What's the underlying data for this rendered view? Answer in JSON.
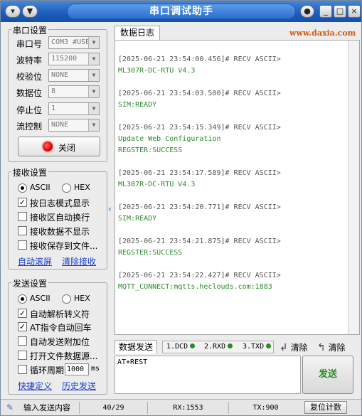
{
  "window": {
    "title": "串口调试助手",
    "app_icon": "▾",
    "menu_icon": "▼",
    "pin_icon": "●",
    "min_icon": "_",
    "max_icon": "□",
    "close_icon": "×"
  },
  "serial_settings": {
    "title": "串口设置",
    "port_label": "串口号",
    "port_value": "COM3 #USB",
    "baud_label": "波特率",
    "baud_value": "115200",
    "parity_label": "校验位",
    "parity_value": "NONE",
    "databits_label": "数据位",
    "databits_value": "8",
    "stopbits_label": "停止位",
    "stopbits_value": "1",
    "flow_label": "流控制",
    "flow_value": "NONE",
    "close_button": "关闭",
    "status_color": "#e00000"
  },
  "receive_settings": {
    "title": "接收设置",
    "ascii_label": "ASCII",
    "hex_label": "HEX",
    "opt_log_mode": "按日志模式显示",
    "opt_auto_wrap": "接收区自动换行",
    "opt_hide_data": "接收数据不显示",
    "opt_save_file": "接收保存到文件...",
    "link_autoscroll": "自动滚屏",
    "link_clear": "清除接收"
  },
  "send_settings": {
    "title": "发送设置",
    "ascii_label": "ASCII",
    "hex_label": "HEX",
    "opt_escape": "自动解析转义符",
    "opt_at_crlf": "AT指令自动回车",
    "opt_append": "自动发送附加位",
    "opt_open_file": "打开文件数据源...",
    "opt_cycle": "循环周期",
    "cycle_value": "1000",
    "cycle_unit": "ms",
    "link_shortcut": "快捷定义",
    "link_history": "历史发送"
  },
  "log": {
    "tab_label": "数据日志",
    "brand": "www.daxia.com",
    "entries": [
      {
        "header": "[2025-06-21 23:54:00.456]# RECV ASCII>",
        "lines": [
          "ML307R-DC-RTU V4.3"
        ]
      },
      {
        "header": "[2025-06-21 23:54:03.500]# RECV ASCII>",
        "lines": [
          "SIM:READY"
        ]
      },
      {
        "header": "[2025-06-21 23:54:15.349]# RECV ASCII>",
        "lines": [
          "Update Web Configuration",
          "REGSTER:SUCCESS"
        ]
      },
      {
        "header": "[2025-06-21 23:54:17.589]# RECV ASCII>",
        "lines": [
          "ML307R-DC-RTU V4.3"
        ]
      },
      {
        "header": "[2025-06-21 23:54:20.771]# RECV ASCII>",
        "lines": [
          "SIM:READY"
        ]
      },
      {
        "header": "[2025-06-21 23:54:21.875]# RECV ASCII>",
        "lines": [
          "REGSTER:SUCCESS"
        ]
      },
      {
        "header": "[2025-06-21 23:54:22.427]# RECV ASCII>",
        "lines": [
          "MQTT_CONNECT:mqtts.heclouds.com:1883"
        ]
      }
    ]
  },
  "send": {
    "tab_label": "数据发送",
    "dcd": "1.DCD",
    "rxd": "2.RXD",
    "txd": "3.TXD",
    "clear_label": "清除",
    "clear2_label": "清除",
    "input_value": "AT+REST",
    "send_button": "发送"
  },
  "status_bar": {
    "hint": "输入发送内容",
    "counter": "40/29",
    "rx": "RX:1553",
    "tx": "TX:900",
    "reset_button": "复位计数"
  }
}
